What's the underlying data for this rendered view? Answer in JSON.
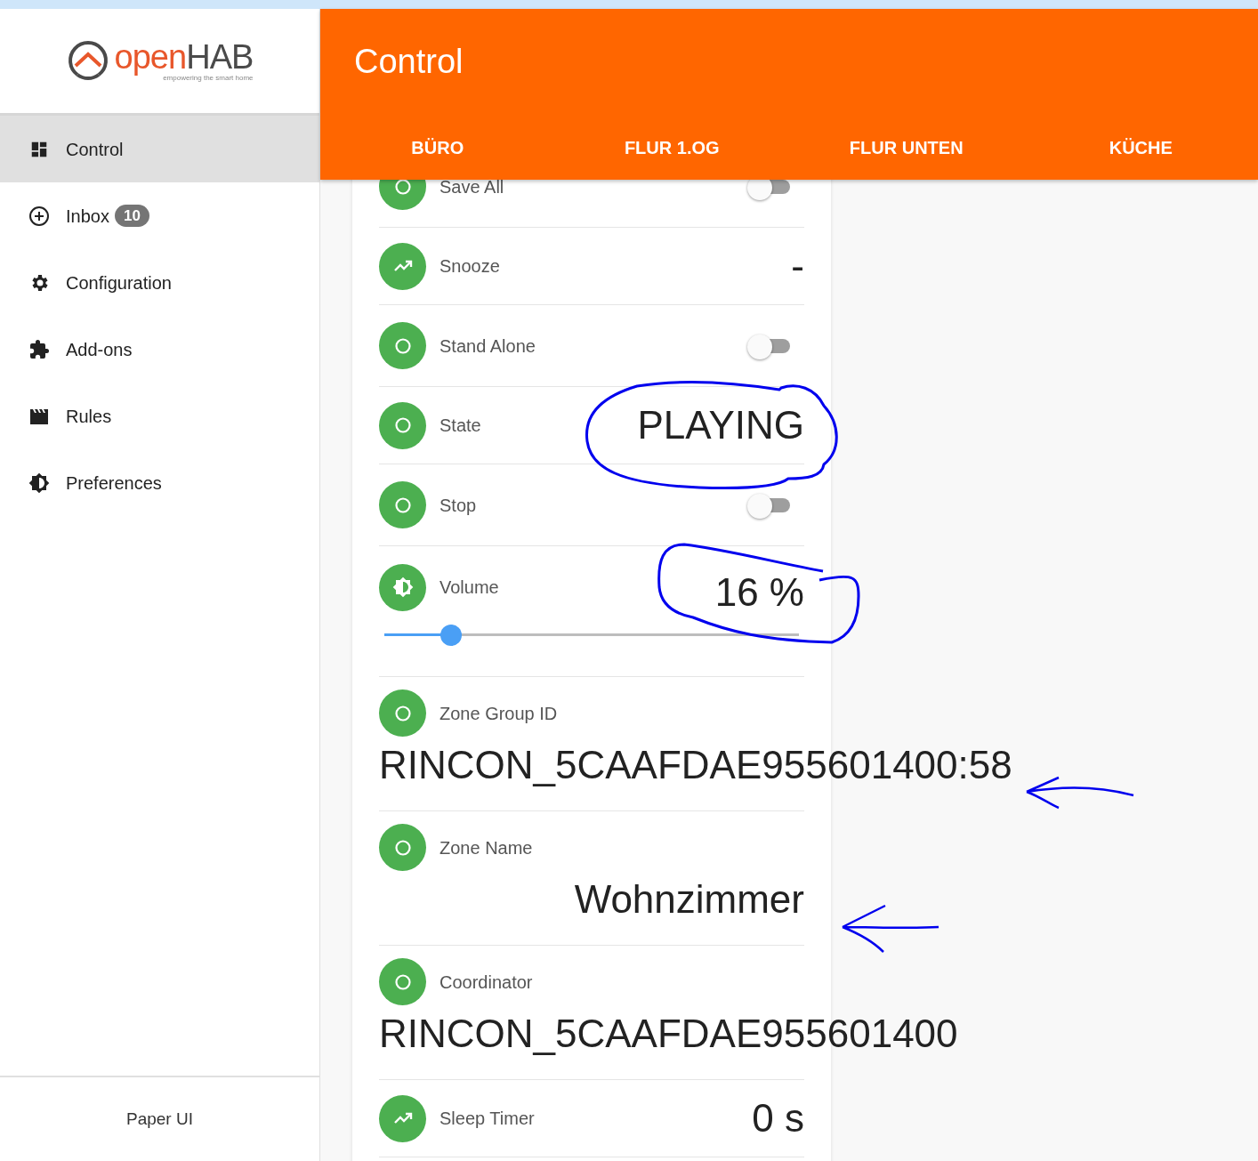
{
  "sidebar": {
    "logo": {
      "word_start": "open",
      "word_end": "HAB",
      "tagline": "empowering the smart home"
    },
    "items": [
      {
        "label": "Control",
        "selected": true
      },
      {
        "label": "Inbox",
        "badge": "10",
        "selected": false
      },
      {
        "label": "Configuration",
        "selected": false
      },
      {
        "label": "Add-ons",
        "selected": false
      },
      {
        "label": "Rules",
        "selected": false
      },
      {
        "label": "Preferences",
        "selected": false
      }
    ],
    "footer": "Paper UI"
  },
  "header": {
    "title": "Control",
    "tabs": [
      {
        "label": "BÜRO",
        "selected": false
      },
      {
        "label": "FLUR 1.OG",
        "selected": false
      },
      {
        "label": "FLUR UNTEN",
        "selected": false
      },
      {
        "label": "KÜCHE",
        "selected": false
      }
    ]
  },
  "items": [
    {
      "kind": "switch",
      "label": "Save All",
      "on": false
    },
    {
      "kind": "number",
      "label": "Snooze",
      "value": "-"
    },
    {
      "kind": "switch",
      "label": "Stand Alone",
      "on": false
    },
    {
      "kind": "text",
      "label": "State",
      "value": "PLAYING"
    },
    {
      "kind": "switch",
      "label": "Stop",
      "on": false
    },
    {
      "kind": "slider",
      "label": "Volume",
      "value": "16 %",
      "level": 0.16
    },
    {
      "kind": "text_wrapped",
      "label": "Zone Group ID",
      "value": "RINCON_5CAAFDAE955601400:58"
    },
    {
      "kind": "text_wrapped",
      "label": "Zone Name",
      "value": "Wohnzimmer"
    },
    {
      "kind": "text_wrapped",
      "label": "Coordinator",
      "value": "RINCON_5CAAFDAE955601400"
    },
    {
      "kind": "number",
      "label": "Sleep Timer",
      "value": "0 s"
    }
  ]
}
